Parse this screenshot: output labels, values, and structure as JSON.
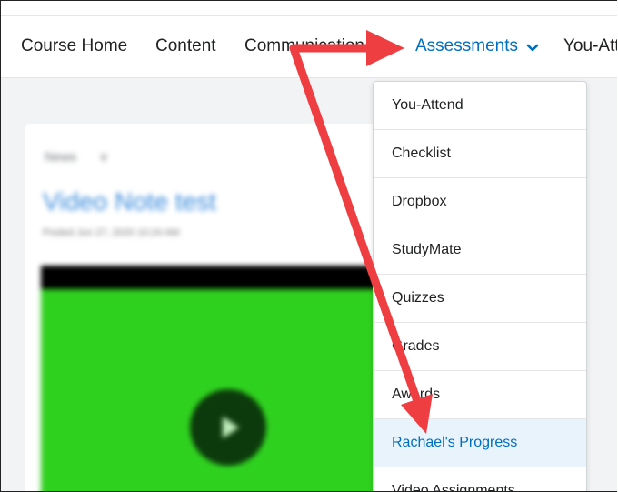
{
  "nav": {
    "items": [
      {
        "label": "Course Home"
      },
      {
        "label": "Content"
      },
      {
        "label": "Communication"
      },
      {
        "label": "Assessments"
      },
      {
        "label": "You-Attend"
      }
    ]
  },
  "content": {
    "news_label": "News",
    "post_title": "Video Note test",
    "posted_text": "Posted Jun 27, 2020 10:24 AM"
  },
  "dropdown": {
    "items": [
      {
        "label": "You-Attend"
      },
      {
        "label": "Checklist"
      },
      {
        "label": "Dropbox"
      },
      {
        "label": "StudyMate"
      },
      {
        "label": "Quizzes"
      },
      {
        "label": "Grades"
      },
      {
        "label": "Awards"
      },
      {
        "label": "Rachael's Progress"
      },
      {
        "label": "Video Assignments"
      }
    ]
  },
  "colors": {
    "accent": "#006fbf",
    "annotation_arrow": "#ef3e42",
    "highlight_bg": "#e8f3fb",
    "video_green": "#2fd11f"
  }
}
